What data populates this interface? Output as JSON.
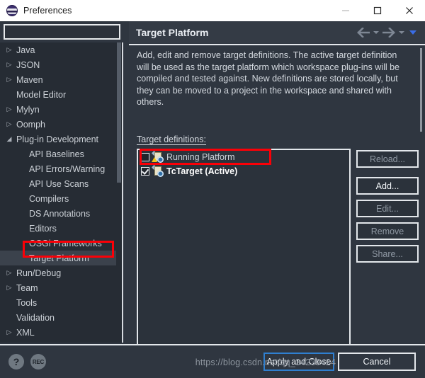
{
  "window": {
    "title": "Preferences",
    "icon": "eclipse-icon",
    "controls": {
      "minimize": "minimize-icon",
      "maximize": "maximize-icon",
      "close": "close-icon"
    }
  },
  "sidebar": {
    "filter": {
      "value": "",
      "placeholder": ""
    },
    "items": [
      {
        "label": "Java",
        "depth": 1,
        "twisty": "collapsed",
        "selected": false
      },
      {
        "label": "JSON",
        "depth": 1,
        "twisty": "collapsed",
        "selected": false
      },
      {
        "label": "Maven",
        "depth": 1,
        "twisty": "collapsed",
        "selected": false
      },
      {
        "label": "Model Editor",
        "depth": 1,
        "twisty": "none",
        "selected": false
      },
      {
        "label": "Mylyn",
        "depth": 1,
        "twisty": "collapsed",
        "selected": false
      },
      {
        "label": "Oomph",
        "depth": 1,
        "twisty": "collapsed",
        "selected": false
      },
      {
        "label": "Plug-in Development",
        "depth": 1,
        "twisty": "expanded",
        "selected": false
      },
      {
        "label": "API Baselines",
        "depth": 2,
        "twisty": "none",
        "selected": false
      },
      {
        "label": "API Errors/Warning",
        "depth": 2,
        "twisty": "none",
        "selected": false
      },
      {
        "label": "API Use Scans",
        "depth": 2,
        "twisty": "none",
        "selected": false
      },
      {
        "label": "Compilers",
        "depth": 2,
        "twisty": "none",
        "selected": false
      },
      {
        "label": "DS Annotations",
        "depth": 2,
        "twisty": "none",
        "selected": false
      },
      {
        "label": "Editors",
        "depth": 2,
        "twisty": "none",
        "selected": false
      },
      {
        "label": "OSGi Frameworks",
        "depth": 2,
        "twisty": "none",
        "selected": false
      },
      {
        "label": "Target Platform",
        "depth": 2,
        "twisty": "none",
        "selected": true
      },
      {
        "label": "Run/Debug",
        "depth": 1,
        "twisty": "collapsed",
        "selected": false
      },
      {
        "label": "Team",
        "depth": 1,
        "twisty": "collapsed",
        "selected": false
      },
      {
        "label": "Tools",
        "depth": 1,
        "twisty": "none",
        "selected": false
      },
      {
        "label": "Validation",
        "depth": 1,
        "twisty": "none",
        "selected": false
      },
      {
        "label": "XML",
        "depth": 1,
        "twisty": "collapsed",
        "selected": false
      }
    ]
  },
  "content": {
    "title": "Target Platform",
    "nav": {
      "back": "back-arrow-icon",
      "back_menu": "chevron-down-icon",
      "forward": "forward-arrow-icon",
      "forward_menu": "chevron-down-icon",
      "view_menu": "triangle-down-icon"
    },
    "description": "Add, edit and remove target definitions.  The active target definition will be used as the target platform which workspace plug-ins will be compiled and tested against.  New definitions are stored locally, but they can be moved to a project in the workspace and shared with others.",
    "definitions_label": "Target definitions:",
    "definitions": [
      {
        "label": "Running Platform",
        "checked": false,
        "active": false,
        "icon": "target-definition-warning-icon"
      },
      {
        "label": "TcTarget (Active)",
        "checked": true,
        "active": true,
        "icon": "target-definition-icon"
      }
    ],
    "buttons": [
      {
        "label": "Reload...",
        "enabled": false
      },
      {
        "label": "Add...",
        "enabled": true
      },
      {
        "label": "Edit...",
        "enabled": false
      },
      {
        "label": "Remove",
        "enabled": false
      },
      {
        "label": "Share...",
        "enabled": false
      }
    ]
  },
  "footer": {
    "help_icon": "?",
    "rec_icon": "REC",
    "apply_label": "Apply and Close",
    "cancel_label": "Cancel"
  },
  "watermark": "https://blog.csdn.net/qq_34239424",
  "colors": {
    "window_bg": "#2f3640",
    "panel_bg": "#262c34",
    "border": "#e3e7eb",
    "text": "#d6dae0",
    "accent_blue": "#2f7fd0",
    "annotation_red": "#fb0007"
  }
}
